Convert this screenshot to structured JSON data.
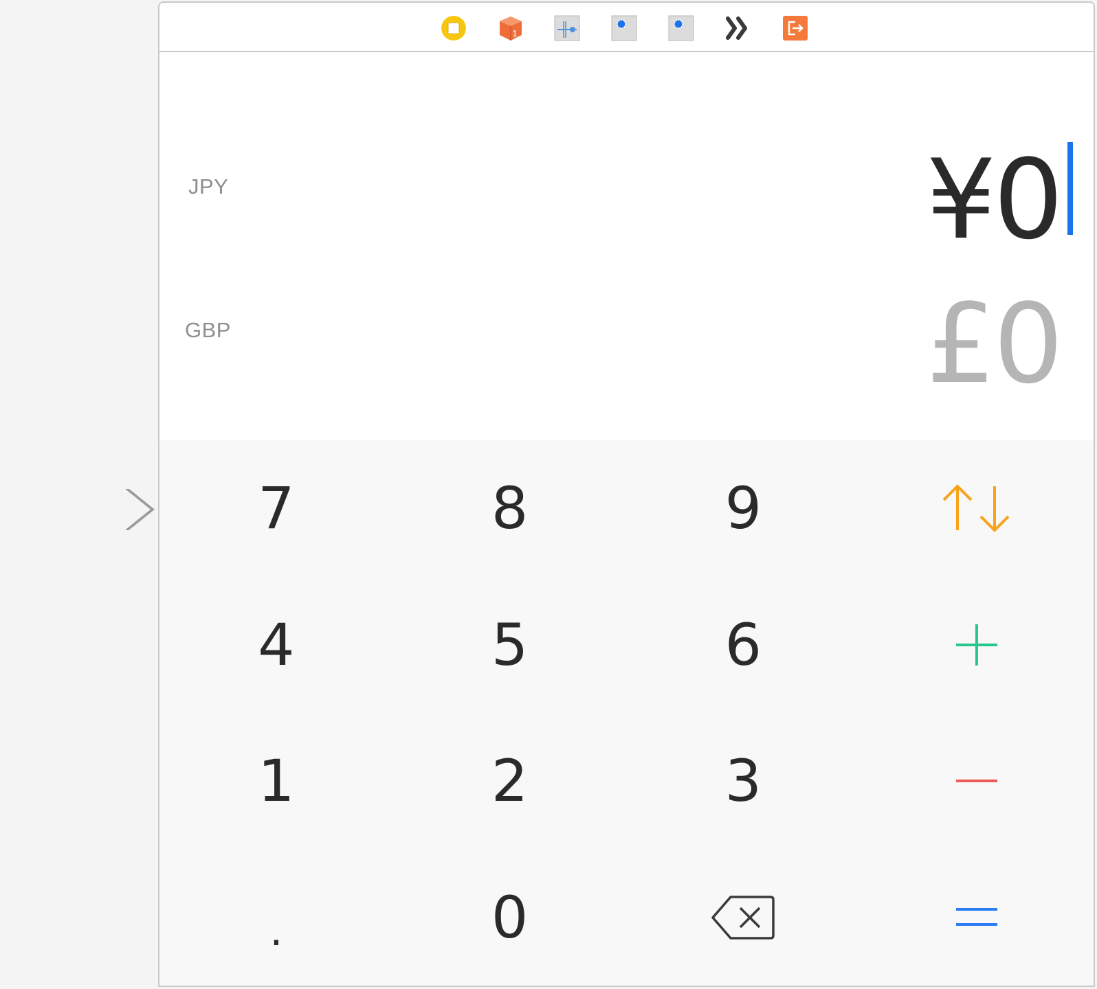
{
  "dock": {
    "icons": [
      "view-controller-icon",
      "first-responder-icon",
      "gesture-recognizer-icon",
      "object-icon",
      "object-icon",
      "segue-icon",
      "exit-icon"
    ]
  },
  "status_bar": {
    "battery_icon": "battery-icon"
  },
  "converter": {
    "primary_currency_code": "JPY",
    "primary_amount": "¥0",
    "secondary_currency_code": "GBP",
    "secondary_amount": "£0"
  },
  "keypad": {
    "rows": [
      [
        "7",
        "8",
        "9",
        "swap-icon"
      ],
      [
        "4",
        "5",
        "6",
        "plus-icon"
      ],
      [
        "1",
        "2",
        "3",
        "minus-icon"
      ],
      [
        ".",
        "0",
        "backspace-icon",
        "equals-icon"
      ]
    ]
  },
  "colors": {
    "caret": "#1a73e8",
    "swap": "#f9a31c",
    "plus": "#27c68a",
    "minus": "#f05a5a",
    "equals": "#2c7cf6",
    "dock_view_controller": "#f7c70f",
    "dock_cube": "#ef6d3a",
    "dock_exit": "#f4793b"
  }
}
